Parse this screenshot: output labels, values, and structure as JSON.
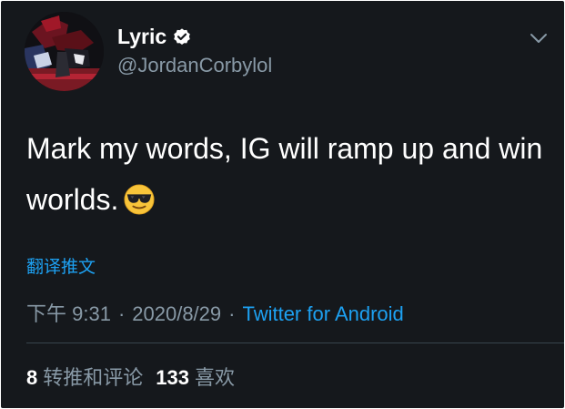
{
  "author": {
    "display_name": "Lyric",
    "handle": "@JordanCorbylol",
    "verified": true
  },
  "tweet": {
    "text": "Mark my words, IG will ramp up and win worlds.",
    "emoji": "smiling-face-with-sunglasses"
  },
  "translate_label": "翻译推文",
  "meta": {
    "time": "下午 9:31",
    "separator": "·",
    "date": "2020/8/29",
    "source": "Twitter for Android"
  },
  "stats": {
    "retweets_count": "8",
    "retweets_label": "转推和评论",
    "likes_count": "133",
    "likes_label": "喜欢"
  },
  "colors": {
    "background": "#15181c",
    "text": "#ffffff",
    "secondary_text": "#8899a6",
    "link": "#1da1f2",
    "divider": "#38444d"
  }
}
